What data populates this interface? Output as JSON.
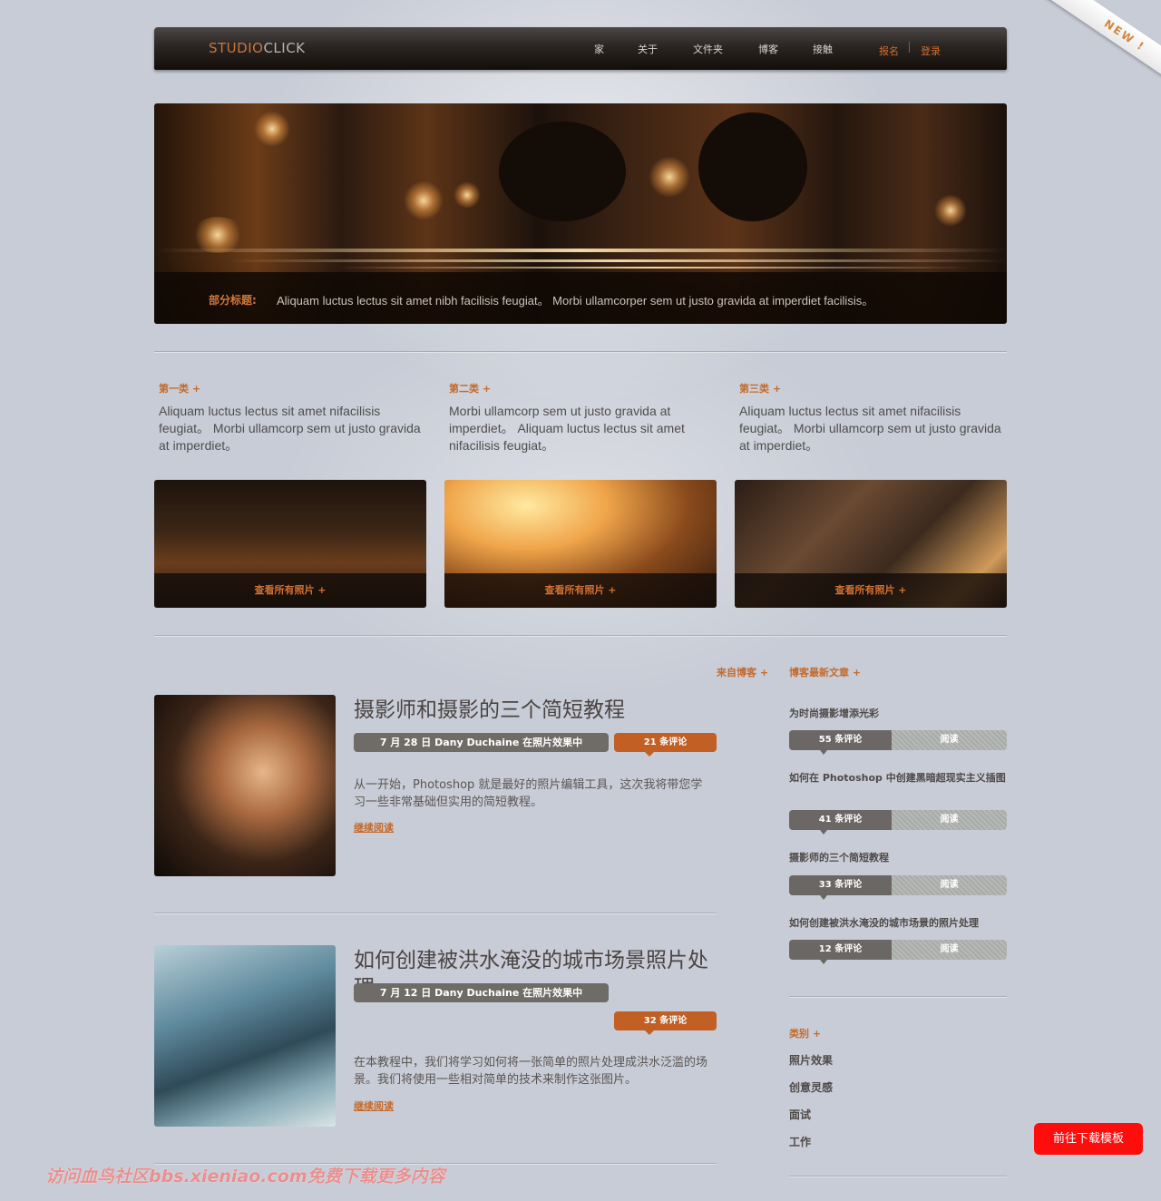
{
  "logo": {
    "part1": "STUDIO",
    "part2": "CLICK"
  },
  "nav": {
    "items": [
      "家",
      "关于",
      "文件夹",
      "博客",
      "接触"
    ],
    "register": "报名",
    "login": "登录"
  },
  "ribbon": "NEW !",
  "hero": {
    "label": "部分标题:",
    "text": "Aliquam luctus lectus sit amet nibh facilisis feugiat。 Morbi ullamcorper sem ut justo gravida at imperdiet facilisis。"
  },
  "features": [
    {
      "title": "第一类 +",
      "text": "Aliquam luctus lectus sit amet nifacilisis feugiat。 Morbi ullamcorp sem ut justo gravida at imperdiet。"
    },
    {
      "title": "第二类 +",
      "text": "Morbi ullamcorp sem ut justo gravida at imperdiet。 Aliquam luctus lectus sit amet nifacilisis feugiat。"
    },
    {
      "title": "第三类 +",
      "text": "Aliquam luctus lectus sit amet nifacilisis feugiat。 Morbi ullamcorp sem ut justo gravida at imperdiet。"
    }
  ],
  "thumbs": [
    "查看所有照片 +",
    "查看所有照片 +",
    "查看所有照片 +"
  ],
  "blog": {
    "from_blog": "来自博客 +",
    "posts": [
      {
        "title": "摄影师和摄影的三个简短教程",
        "meta": "7 月 28 日 Dany Duchaine 在照片效果中",
        "comments": "21 条评论",
        "excerpt": "从一开始，Photoshop 就是最好的照片编辑工具，这次我将带您学习一些非常基础但实用的简短教程。",
        "read_more": "继续阅读"
      },
      {
        "title": "如何创建被洪水淹没的城市场景照片处理",
        "meta": "7 月 12 日 Dany Duchaine 在照片效果中",
        "comments": "32 条评论",
        "excerpt": "在本教程中，我们将学习如何将一张简单的照片处理成洪水泛滥的场景。我们将使用一些相对简单的技术来制作这张图片。",
        "read_more": "继续阅读"
      }
    ]
  },
  "sidebar": {
    "latest_title": "博客最新文章 +",
    "latest": [
      {
        "title": "为时尚摄影增添光彩",
        "comments": "55 条评论",
        "read": "阅读"
      },
      {
        "title": "如何在 Photoshop 中创建黑暗超现实主义插图",
        "comments": "41 条评论",
        "read": "阅读"
      },
      {
        "title": "摄影师的三个简短教程",
        "comments": "33 条评论",
        "read": "阅读"
      },
      {
        "title": "如何创建被洪水淹没的城市场景的照片处理",
        "comments": "12 条评论",
        "read": "阅读"
      }
    ],
    "categories_title": "类别 +",
    "categories": [
      "照片效果",
      "创意灵感",
      "面试",
      "工作"
    ]
  },
  "download_button": "前往下载模板",
  "watermark": "访问血鸟社区bbs.xieniao.com免费下载更多内容",
  "colors": {
    "accent": "#c46a2b",
    "header_dark": "#1e1814",
    "download_red": "#ff0d0d"
  }
}
